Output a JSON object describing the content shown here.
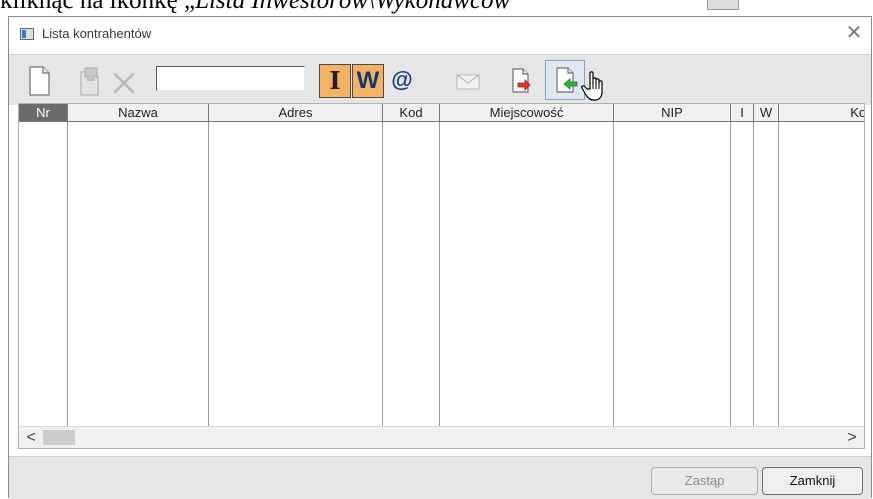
{
  "document": {
    "line_text": "kliknąć na ikonkę „",
    "line_italic": "Lista Inwestorów\\Wykonawców",
    "line_end": "”"
  },
  "window": {
    "title": "Lista kontrahentów",
    "close_glyph": "✕"
  },
  "toolbar": {
    "search_value": "",
    "investor_label": "I",
    "contractor_label": "W",
    "email_label": "@"
  },
  "table": {
    "columns": [
      "Nr",
      "Nazwa",
      "Adres",
      "Kod",
      "Miejscowość",
      "NIP",
      "I",
      "W",
      "Kont"
    ],
    "rows": []
  },
  "scrollbar": {
    "left_glyph": "<",
    "right_glyph": ">"
  },
  "footer": {
    "replace_label": "Zastąp",
    "close_label": "Zamknij"
  },
  "colors": {
    "toggle_bg": "#f4b266",
    "toolbar_bg": "#e6e6e6",
    "header_selected_bg": "#6b6b6b"
  }
}
